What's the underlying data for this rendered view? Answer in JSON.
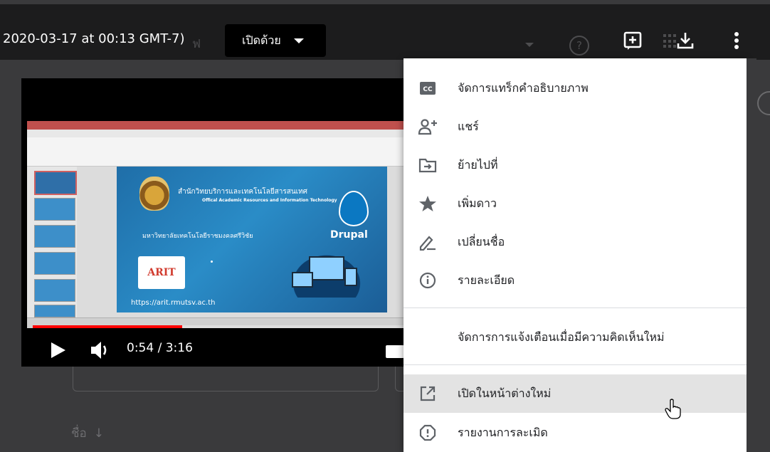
{
  "header": {
    "file_title": "2020-03-17 at 00:13 GMT-7)",
    "ghost_text": "ฟ",
    "open_with_label": "เปิดด้วย",
    "ghost_help": "?"
  },
  "video": {
    "slide": {
      "org_name_th": "สำนักวิทยบริการและเทคโนโลยีสารสนเทศ",
      "org_name_en": "Offical Academic Resources and Information Technology",
      "university_th": "มหาวิทยาลัยเทคโนโลยีราชมงคลศรีวิชัย",
      "drupal_label": "Drupal",
      "arit_label": "ARIT",
      "url": "https://arit.rmutsv.ac.th"
    },
    "time_display": "0:54 / 3:16",
    "progress_fraction": 0.4
  },
  "menu": {
    "items": [
      {
        "id": "manage-captions",
        "label": "จัดการแทร็กคำอธิบายภาพ",
        "icon": "cc-icon"
      },
      {
        "id": "share",
        "label": "แชร์",
        "icon": "person-add-icon"
      },
      {
        "id": "move-to",
        "label": "ย้ายไปที่",
        "icon": "folder-move-icon"
      },
      {
        "id": "add-star",
        "label": "เพิ่มดาว",
        "icon": "star-icon"
      },
      {
        "id": "rename",
        "label": "เปลี่ยนชื่อ",
        "icon": "pencil-icon"
      },
      {
        "id": "details",
        "label": "รายละเอียด",
        "icon": "info-icon"
      },
      {
        "id": "comment-notifications",
        "label": "จัดการการแจ้งเตือนเมื่อมีความคิดเห็นใหม่",
        "icon": ""
      },
      {
        "id": "open-new-window",
        "label": "เปิดในหน้าต่างใหม่",
        "icon": "open-in-new-icon"
      },
      {
        "id": "report-abuse",
        "label": "รายงานการละเมิด",
        "icon": "report-icon"
      }
    ],
    "hovered_item": "open-new-window"
  },
  "background": {
    "sort_label": "ชื่อ",
    "sort_arrow": "↓"
  },
  "colors": {
    "overlay_bar": "#1c1c1d",
    "menu_bg": "#ffffff",
    "menu_hover": "#e3e3e3",
    "progress": "#ff0000"
  }
}
